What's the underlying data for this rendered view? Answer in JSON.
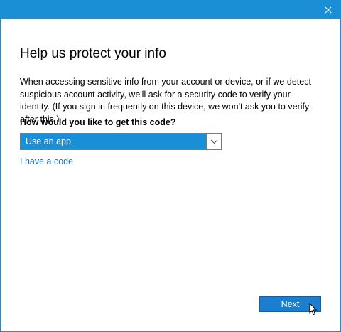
{
  "window": {
    "accent_color": "#1a8fd6",
    "close_icon": "close-icon"
  },
  "main": {
    "heading": "Help us protect your info",
    "description": "When accessing sensitive info from your account or device, or if we detect suspicious account activity, we'll ask for a security code to verify your identity. (If you sign in frequently on this device, we won't ask you to verify after this.)",
    "question": "How would you like to get this code?",
    "method_select": {
      "selected": "Use an app"
    },
    "have_code_link": "I have a code"
  },
  "footer": {
    "next_label": "Next"
  }
}
